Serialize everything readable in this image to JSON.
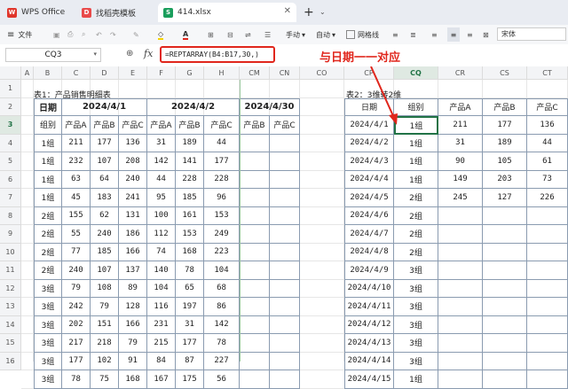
{
  "tabs": [
    {
      "label": "WPS Office",
      "icon": "wps-logo-icon",
      "color": "#e0362b"
    },
    {
      "label": "找稻壳模板",
      "icon": "docer-logo-icon",
      "color": "#e94a4a"
    },
    {
      "label": "414.xlsx",
      "icon": "spreadsheet-icon",
      "color": "#1a9e5c"
    }
  ],
  "toolbar": {
    "file_label": "文件",
    "wrap_label": "手动",
    "auto_label": "自动",
    "gridlines_label": "网格线",
    "font_name": "宋体"
  },
  "formula_bar": {
    "name_box": "CQ3",
    "fx_label": "fx",
    "formula": "=REPTARRAY(B4:B17,30,)"
  },
  "annotation": {
    "text": "与日期一一对应",
    "color": "#e0261c"
  },
  "col_headers": {
    "left": [
      "A",
      "B",
      "C",
      "D",
      "E",
      "F",
      "G",
      "H",
      "CM",
      "CN",
      "CO",
      "CP",
      "CQ",
      "CR",
      "CS",
      "CT"
    ]
  },
  "row_headers": [
    "1",
    "2",
    "3",
    "4",
    "5",
    "6",
    "7",
    "8",
    "9",
    "10",
    "11",
    "12",
    "13",
    "14",
    "15",
    "16"
  ],
  "table1": {
    "title": "表1：产品销售明细表",
    "date_label": "日期",
    "dates": [
      "2024/4/1",
      "2024/4/2",
      "2024/4/30"
    ],
    "group_label": "组别",
    "product_headers": [
      "产品A",
      "产品B",
      "产品C",
      "产品A",
      "产品B",
      "产品C",
      "产品B",
      "产品C"
    ],
    "rows": [
      [
        "1组",
        "211",
        "177",
        "136",
        "31",
        "189",
        "44"
      ],
      [
        "1组",
        "232",
        "107",
        "208",
        "142",
        "141",
        "177"
      ],
      [
        "1组",
        "63",
        "64",
        "240",
        "44",
        "228",
        "228"
      ],
      [
        "1组",
        "45",
        "183",
        "241",
        "95",
        "185",
        "96"
      ],
      [
        "2组",
        "155",
        "62",
        "131",
        "100",
        "161",
        "153"
      ],
      [
        "2组",
        "55",
        "240",
        "186",
        "112",
        "153",
        "249"
      ],
      [
        "2组",
        "77",
        "185",
        "166",
        "74",
        "168",
        "223"
      ],
      [
        "2组",
        "240",
        "107",
        "137",
        "140",
        "78",
        "104"
      ],
      [
        "3组",
        "79",
        "108",
        "89",
        "104",
        "65",
        "68"
      ],
      [
        "3组",
        "242",
        "79",
        "128",
        "116",
        "197",
        "86"
      ],
      [
        "3组",
        "202",
        "151",
        "166",
        "231",
        "31",
        "142"
      ],
      [
        "3组",
        "217",
        "218",
        "79",
        "215",
        "177",
        "78"
      ],
      [
        "3组",
        "177",
        "102",
        "91",
        "84",
        "87",
        "227"
      ],
      [
        "3组",
        "78",
        "75",
        "168",
        "167",
        "175",
        "56"
      ]
    ]
  },
  "table2": {
    "title": "表2：3维转2维",
    "headers": [
      "日期",
      "组别",
      "产品A",
      "产品B",
      "产品C"
    ],
    "rows": [
      [
        "2024/4/1",
        "1组",
        "211",
        "177",
        "136"
      ],
      [
        "2024/4/2",
        "1组",
        "31",
        "189",
        "44"
      ],
      [
        "2024/4/3",
        "1组",
        "90",
        "105",
        "61"
      ],
      [
        "2024/4/4",
        "1组",
        "149",
        "203",
        "73"
      ],
      [
        "2024/4/5",
        "2组",
        "245",
        "127",
        "226"
      ],
      [
        "2024/4/6",
        "2组",
        "",
        "",
        ""
      ],
      [
        "2024/4/7",
        "2组",
        "",
        "",
        ""
      ],
      [
        "2024/4/8",
        "2组",
        "",
        "",
        ""
      ],
      [
        "2024/4/9",
        "3组",
        "",
        "",
        ""
      ],
      [
        "2024/4/10",
        "3组",
        "",
        "",
        ""
      ],
      [
        "2024/4/11",
        "3组",
        "",
        "",
        ""
      ],
      [
        "2024/4/12",
        "3组",
        "",
        "",
        ""
      ],
      [
        "2024/4/13",
        "3组",
        "",
        "",
        ""
      ],
      [
        "2024/4/14",
        "3组",
        "",
        "",
        ""
      ],
      [
        "2024/4/15",
        "1组",
        "",
        "",
        ""
      ]
    ]
  }
}
